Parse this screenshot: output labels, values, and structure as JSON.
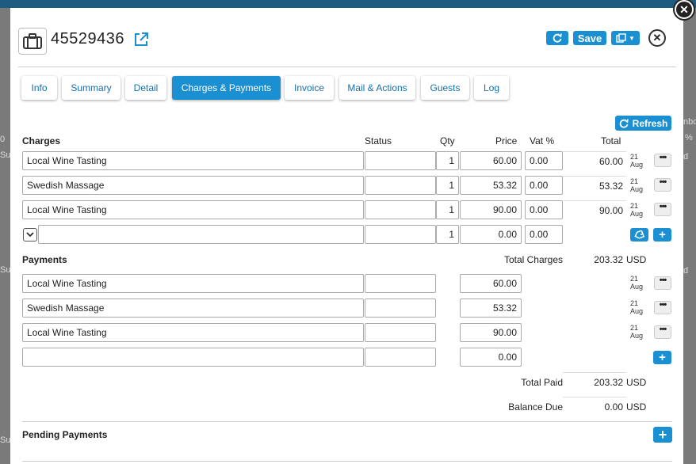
{
  "reservation": {
    "number": "45529436"
  },
  "header_buttons": {
    "save_label": "Save"
  },
  "tabs": [
    {
      "label": "Info"
    },
    {
      "label": "Summary"
    },
    {
      "label": "Detail"
    },
    {
      "label": "Charges & Payments",
      "active": true
    },
    {
      "label": "Invoice"
    },
    {
      "label": "Mail & Actions"
    },
    {
      "label": "Guests"
    },
    {
      "label": "Log"
    }
  ],
  "refresh_label": "Refresh",
  "charges": {
    "title": "Charges",
    "columns": {
      "status": "Status",
      "qty": "Qty",
      "price": "Price",
      "vat": "Vat %",
      "total": "Total"
    },
    "rows": [
      {
        "description": "Local Wine Tasting",
        "status": "",
        "qty": "1",
        "price": "60.00",
        "vat": "0.00",
        "total": "60.00",
        "day": "21",
        "month": "Aug"
      },
      {
        "description": "Swedish Massage",
        "status": "",
        "qty": "1",
        "price": "53.32",
        "vat": "0.00",
        "total": "53.32",
        "day": "21",
        "month": "Aug"
      },
      {
        "description": "Local Wine Tasting",
        "status": "",
        "qty": "1",
        "price": "90.00",
        "vat": "0.00",
        "total": "90.00",
        "day": "21",
        "month": "Aug"
      }
    ],
    "new_row": {
      "description": "",
      "status": "",
      "qty": "1",
      "price": "0.00",
      "vat": "0.00"
    },
    "total_label": "Total Charges",
    "total_value": "203.32",
    "currency": "USD"
  },
  "payments": {
    "title": "Payments",
    "rows": [
      {
        "description": "Local Wine Tasting",
        "method": "",
        "amount": "60.00",
        "day": "21",
        "month": "Aug"
      },
      {
        "description": "Swedish Massage",
        "method": "",
        "amount": "53.32",
        "day": "21",
        "month": "Aug"
      },
      {
        "description": "Local Wine Tasting",
        "method": "",
        "amount": "90.00",
        "day": "21",
        "month": "Aug"
      }
    ],
    "new_row": {
      "description": "",
      "method": "",
      "amount": "0.00"
    },
    "total_paid_label": "Total Paid",
    "total_paid_value": "203.32",
    "balance_label": "Balance Due",
    "balance_value": "0.00",
    "currency": "USD"
  },
  "pending": {
    "title": "Pending Payments"
  },
  "dots_label": "•••",
  "background_fragments": [
    "nbo",
    "%",
    "d",
    "d",
    "Sur",
    "Sur",
    "Sur",
    "0"
  ],
  "colors": {
    "accent": "#1a90d3",
    "link": "#1670ad"
  }
}
